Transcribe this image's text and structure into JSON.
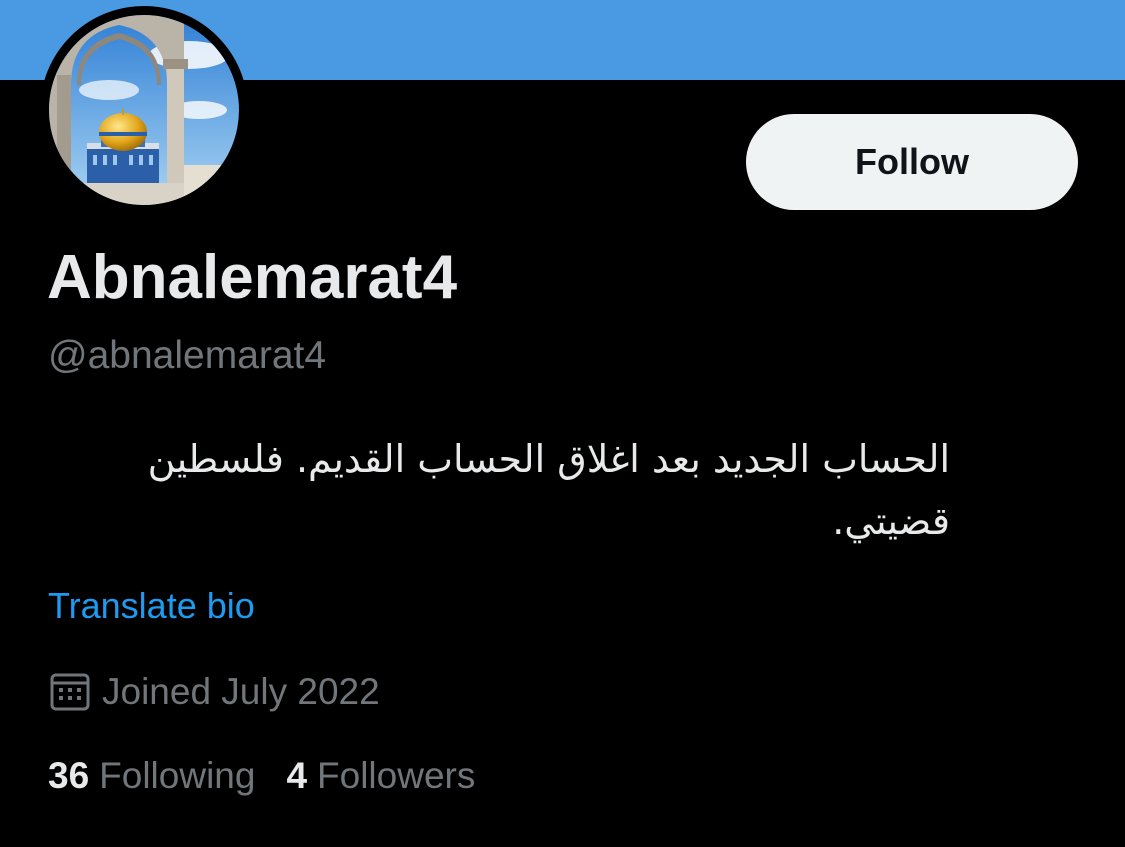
{
  "colors": {
    "banner": "#4a99e3",
    "background": "#000000",
    "accent_link": "#1d9bf0",
    "secondary_text": "#71767b",
    "primary_text": "#e7e9ea",
    "follow_button_bg": "#eff3f4"
  },
  "profile": {
    "avatar_icon": "dome-of-the-rock-avatar",
    "display_name": "Abnalemarat4",
    "handle": "@abnalemarat4",
    "bio": "الحساب الجديد بعد اغلاق الحساب القديم. فلسطين قضيتي.",
    "translate_label": "Translate bio",
    "joined_icon": "calendar-icon",
    "joined": "Joined July 2022",
    "stats": {
      "following_count": "36",
      "following_label": "Following",
      "followers_count": "4",
      "followers_label": "Followers"
    }
  },
  "actions": {
    "follow_label": "Follow"
  }
}
